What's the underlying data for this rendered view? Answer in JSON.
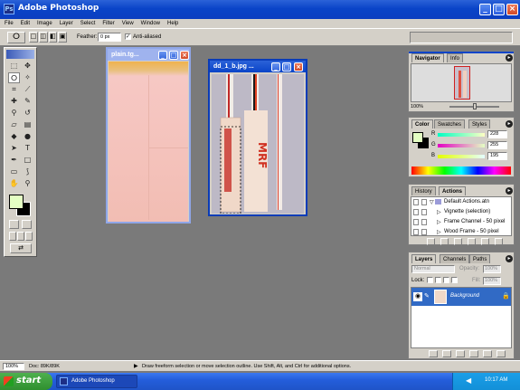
{
  "app": {
    "title": "Adobe Photoshop",
    "menu": [
      "File",
      "Edit",
      "Image",
      "Layer",
      "Select",
      "Filter",
      "View",
      "Window",
      "Help"
    ]
  },
  "options_bar": {
    "feather_label": "Feather:",
    "feather_value": "0 px",
    "antialias_label": "Anti-aliased",
    "antialias_checked": true
  },
  "documents": [
    {
      "title": "plain.tg...",
      "active": false
    },
    {
      "title": "dd_1_b.jpg ...",
      "active": true
    }
  ],
  "navigator": {
    "tabs": [
      "Navigator",
      "Info"
    ],
    "zoom": "100%"
  },
  "color": {
    "tabs": [
      "Color",
      "Swatches",
      "Styles"
    ],
    "channels": [
      {
        "label": "R",
        "value": "228"
      },
      {
        "label": "G",
        "value": "255"
      },
      {
        "label": "B",
        "value": "195"
      }
    ]
  },
  "actions": {
    "tabs": [
      "History",
      "Actions"
    ],
    "items": [
      "Default Actions.atn",
      "Vignette (selection)",
      "Frame Channel - 50 pixel",
      "Wood Frame - 50 pixel"
    ]
  },
  "layers": {
    "tabs": [
      "Layers",
      "Channels",
      "Paths"
    ],
    "blend_mode": "Normal",
    "opacity_label": "Opacity:",
    "opacity_value": "100%",
    "lock_label": "Lock:",
    "fill_label": "Fill:",
    "fill_value": "100%",
    "layer_name": "Background"
  },
  "status": {
    "zoom": "100%",
    "doc_info": "Doc: 89K/89K",
    "hint": "Draw freeform selection or move selection outline.  Use Shift, Alt, and Ctrl for additional options."
  },
  "taskbar": {
    "start_label": "start",
    "task_label": "Adobe Photoshop",
    "clock": "10:17 AM"
  },
  "colors": {
    "title_blue": "#0a44c8",
    "chrome_gray": "#d4d0c8",
    "workspace": "#7a7a7a",
    "foreground_swatch": "#e4ffc3",
    "layer_selected": "#316ac5"
  }
}
